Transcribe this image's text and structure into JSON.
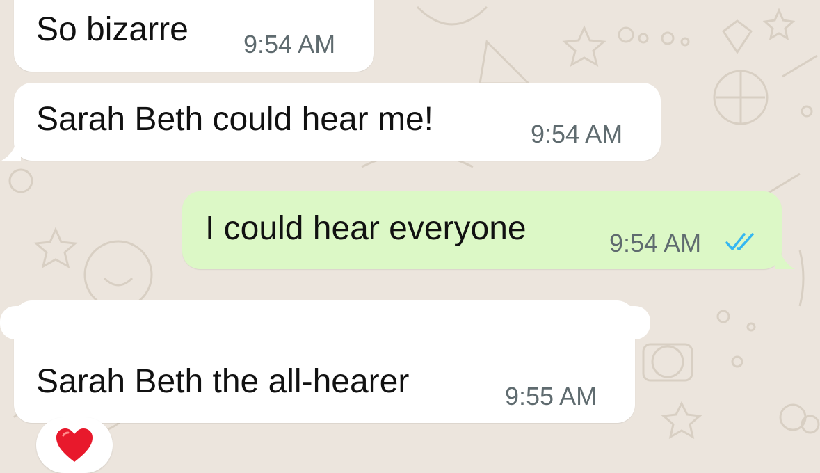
{
  "colors": {
    "chat_background": "#ECE5DD",
    "incoming_bubble": "#FFFFFF",
    "outgoing_bubble": "#DCF8C6",
    "read_receipt": "#34B7F1",
    "reaction_heart": "#E8192C"
  },
  "messages": [
    {
      "direction": "incoming",
      "text": "So bizarre",
      "time": "9:54 AM"
    },
    {
      "direction": "incoming",
      "text": "Sarah Beth could hear me!",
      "time": "9:54 AM"
    },
    {
      "direction": "outgoing",
      "text": "I could hear everyone",
      "time": "9:54 AM",
      "status_icon": "double-check-read-icon"
    },
    {
      "direction": "incoming",
      "text": "Sarah Beth the all-hearer",
      "time": "9:55 AM",
      "reaction_icon": "red-heart-icon"
    }
  ]
}
